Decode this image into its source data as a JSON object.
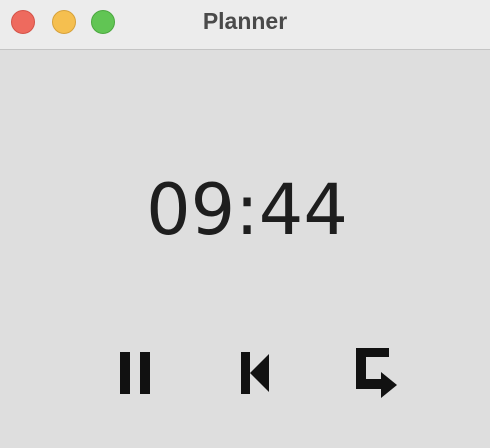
{
  "window": {
    "title": "Planner"
  },
  "timer": {
    "display": "09:44"
  },
  "controls": {
    "pause_icon": "pause-icon",
    "back_icon": "skip-back-icon",
    "repeat_icon": "repeat-icon",
    "icon_color": "#111111"
  },
  "colors": {
    "close": "#ee6a5e",
    "minimize": "#f5bf4f",
    "zoom": "#61c554"
  }
}
